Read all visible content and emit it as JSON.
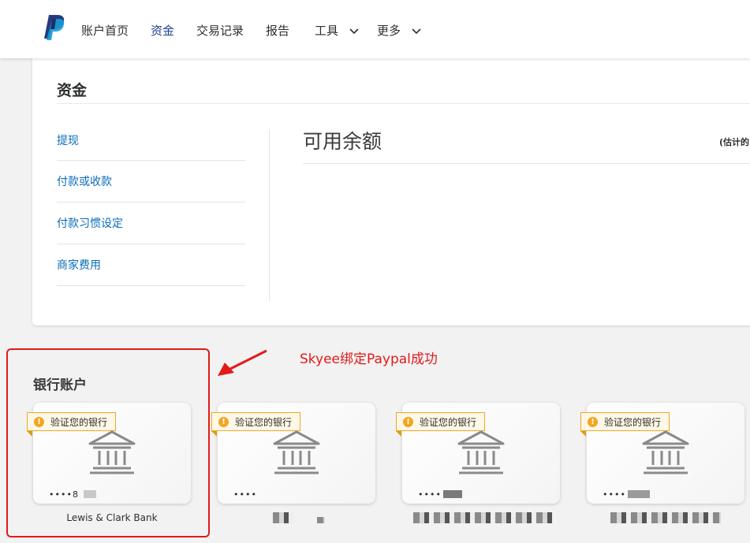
{
  "header": {
    "nav": [
      {
        "label": "账户首页",
        "active": false
      },
      {
        "label": "资金",
        "active": true
      },
      {
        "label": "交易记录",
        "active": false
      },
      {
        "label": "报告",
        "active": false
      },
      {
        "label": "工具",
        "active": false,
        "dropdown": true
      },
      {
        "label": "更多",
        "active": false,
        "dropdown": true
      }
    ]
  },
  "funds": {
    "title": "资金",
    "side_links": [
      "提现",
      "付款或收款",
      "付款习惯设定",
      "商家费用"
    ],
    "balance_title": "可用余额",
    "balance_note": "(估计的"
  },
  "annotation": {
    "text": "Skyee绑定Paypal成功",
    "color": "#e21a1a"
  },
  "bank_accounts": {
    "heading": "银行账户",
    "cards": [
      {
        "badge": "验证您的银行",
        "masked_number": "••••8",
        "name": "Lewis & Clark Bank"
      },
      {
        "badge": "验证您的银行",
        "masked_number": "••••",
        "name": ""
      },
      {
        "badge": "验证您的银行",
        "masked_number": "••••",
        "name": ""
      },
      {
        "badge": "验证您的银行",
        "masked_number": "••••",
        "name": ""
      }
    ]
  },
  "icons": [
    "paypal-logo",
    "chevron-down-icon",
    "warning-icon",
    "bank-icon",
    "arrow-annotation"
  ],
  "colors": {
    "brand": "#1f3f8f",
    "link": "#0a6cb8",
    "warning": "#f2a623"
  }
}
